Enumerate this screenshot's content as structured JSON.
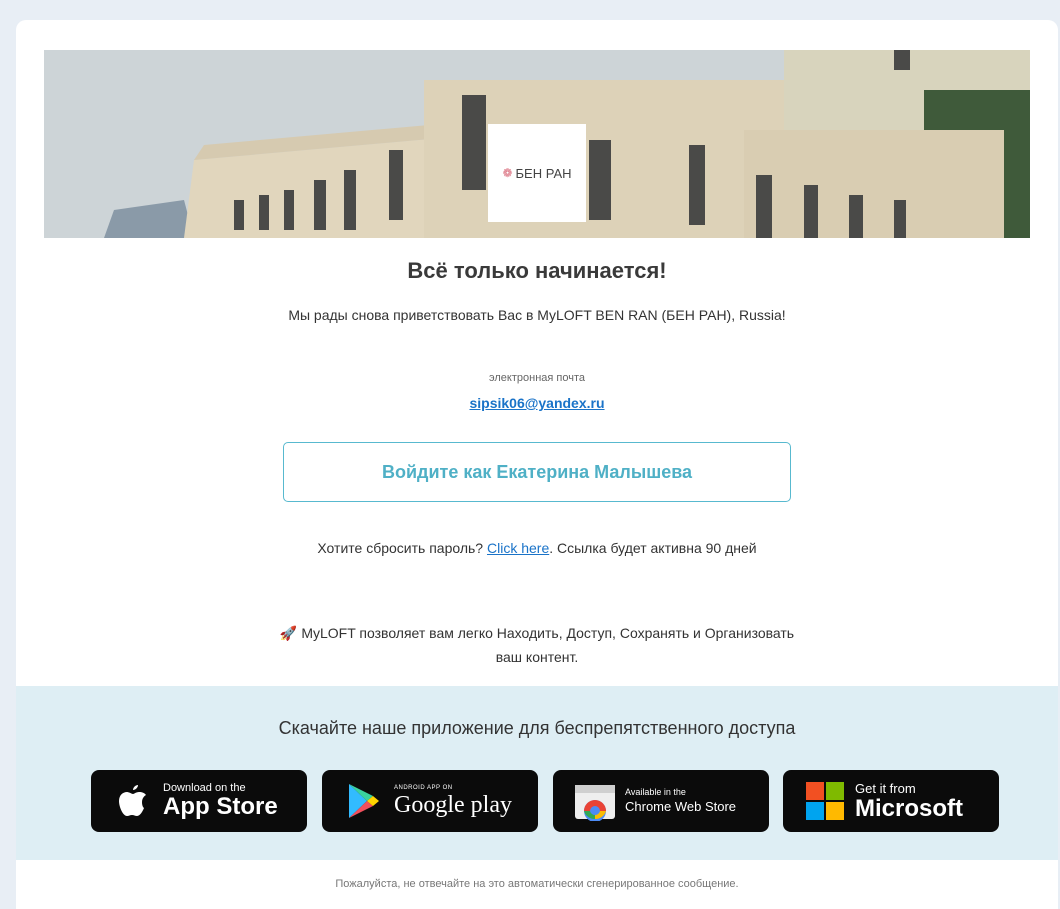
{
  "logo": {
    "text": "БЕН РАН"
  },
  "heading": "Всё только начинается!",
  "welcome": "Мы рады снова приветствовать Вас в MyLOFT BEN RAN (БЕН РАН), Russia!",
  "email": {
    "label": "электронная почта",
    "address": "sipsik06@yandex.ru"
  },
  "login_button": "Войдите как Екатерина Малышева",
  "reset": {
    "before": "Хотите сбросить пароль? ",
    "link": "Click here",
    "after": ". Ссылка будет активна 90 дней"
  },
  "features": "MyLOFT позволяет вам легко Находить, Доступ, Сохранять и Организовать ваш контент.",
  "apps": {
    "title": "Скачайте наше приложение для беспрепятственного доступа",
    "app_store": {
      "small": "Download on the",
      "big": "App Store"
    },
    "google_play": {
      "small": "ANDROID APP ON",
      "big": "Google play"
    },
    "chrome": {
      "small": "Available in the",
      "big": "Chrome Web Store"
    },
    "microsoft": {
      "small": "Get it from",
      "big": "Microsoft"
    }
  },
  "footer": "Пожалуйста, не отвечайте на это автоматически сгенерированное сообщение."
}
